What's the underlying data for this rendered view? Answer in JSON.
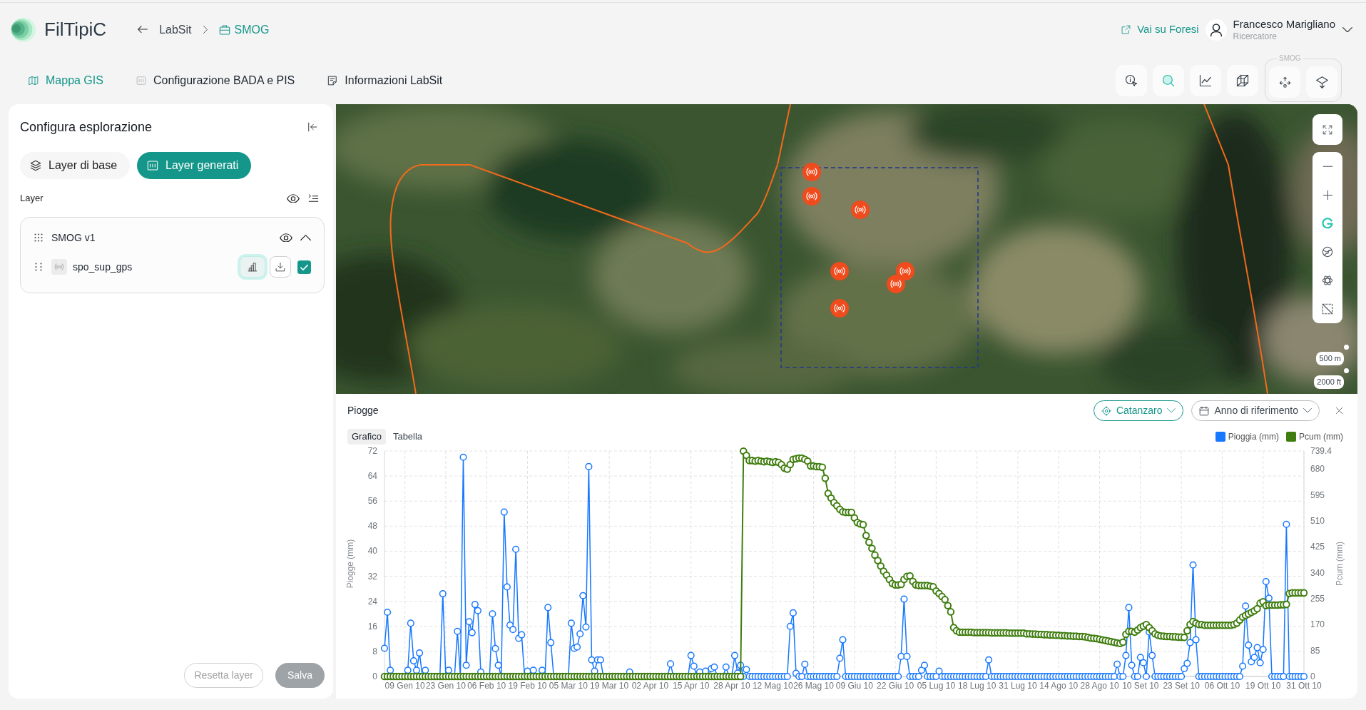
{
  "app": {
    "name": "FilTipiC"
  },
  "breadcrumb": [
    {
      "label": "LabSit",
      "current": false
    },
    {
      "label": "SMOG",
      "current": true
    }
  ],
  "header": {
    "external_link": "Vai su Foresi",
    "user": {
      "name": "Francesco Marigliano",
      "role": "Ricercatore"
    }
  },
  "nav_tabs": [
    {
      "label": "Mappa GIS",
      "selected": true
    },
    {
      "label": "Configurazione BADA e PIS",
      "selected": false
    },
    {
      "label": "Informazioni LabSit",
      "selected": false
    }
  ],
  "toolbar": {
    "tools": [
      {
        "selected": false
      },
      {
        "selected": true
      },
      {
        "selected": false
      },
      {
        "selected": false
      }
    ],
    "group": {
      "label": "SMOG",
      "tools": [
        {
          "selected": false
        },
        {
          "selected": false
        }
      ]
    }
  },
  "sidebar": {
    "title": "Configura esplorazione",
    "segments": [
      {
        "label": "Layer di base",
        "selected": false
      },
      {
        "label": "Layer generati",
        "selected": true
      }
    ],
    "section_label": "Layer",
    "groups": [
      {
        "name": "SMOG v1",
        "expanded": true,
        "layers": [
          {
            "name": "spo_sup_gps",
            "chart_shown": true,
            "checked": true
          }
        ]
      }
    ],
    "buttons": [
      {
        "label": "Resetta layer",
        "kind": "outline",
        "disabled": true
      },
      {
        "label": "Salva",
        "kind": "solid",
        "disabled": true
      }
    ]
  },
  "map": {
    "tools": [
      {
        "selected": true
      },
      {
        "selected": false
      },
      {
        "selected": false
      },
      {
        "selected": false
      }
    ],
    "scale": [
      "500 m",
      "2000 ft"
    ]
  },
  "chart_panel": {
    "title": "Piogge",
    "filters": [
      {
        "label": "Catanzaro",
        "active": true
      },
      {
        "label": "Anno di riferimento",
        "active": false
      }
    ],
    "tabs": [
      {
        "label": "Grafico",
        "selected": true
      },
      {
        "label": "Tabella",
        "selected": false
      }
    ],
    "chart_data": {
      "type": "line",
      "grid": true,
      "legend": "top-right",
      "ylabel": "Piogge (mm)",
      "y2label": "Pcum (mm)",
      "categories": [
        null,
        null,
        null,
        null,
        null,
        null,
        null,
        "09 Gen 10",
        null,
        null,
        null,
        null,
        null,
        null,
        null,
        null,
        null,
        null,
        null,
        null,
        null,
        "23 Gen 10",
        null,
        null,
        null,
        null,
        null,
        null,
        null,
        null,
        null,
        null,
        null,
        null,
        null,
        "06 Feb 10",
        null,
        null,
        null,
        null,
        null,
        null,
        null,
        null,
        null,
        null,
        null,
        null,
        null,
        "19 Feb 10",
        null,
        null,
        null,
        null,
        null,
        null,
        null,
        null,
        null,
        null,
        null,
        null,
        null,
        "05 Mar 10",
        null,
        null,
        null,
        null,
        null,
        null,
        null,
        null,
        null,
        null,
        null,
        null,
        null,
        "19 Mar 10",
        null,
        null,
        null,
        null,
        null,
        null,
        null,
        null,
        null,
        null,
        null,
        null,
        null,
        "02 Apr 10",
        null,
        null,
        null,
        null,
        null,
        null,
        null,
        null,
        null,
        null,
        null,
        null,
        null,
        "15 Apr 10",
        null,
        null,
        null,
        null,
        null,
        null,
        null,
        null,
        null,
        null,
        null,
        null,
        null,
        "28 Apr 10",
        null,
        null,
        null,
        null,
        null,
        null,
        null,
        null,
        null,
        null,
        null,
        null,
        null,
        "12 Mag 10",
        null,
        null,
        null,
        null,
        null,
        null,
        null,
        null,
        null,
        null,
        null,
        null,
        null,
        "26 Mag 10",
        null,
        null,
        null,
        null,
        null,
        null,
        null,
        null,
        null,
        null,
        null,
        null,
        null,
        "09 Giu 10",
        null,
        null,
        null,
        null,
        null,
        null,
        null,
        null,
        null,
        null,
        null,
        null,
        null,
        "22 Giu 10",
        null,
        null,
        null,
        null,
        null,
        null,
        null,
        null,
        null,
        null,
        null,
        null,
        null,
        "05 Lug 10",
        null,
        null,
        null,
        null,
        null,
        null,
        null,
        null,
        null,
        null,
        null,
        null,
        null,
        "18 Lug 10",
        null,
        null,
        null,
        null,
        null,
        null,
        null,
        null,
        null,
        null,
        null,
        null,
        null,
        "31 Lug 10",
        null,
        null,
        null,
        null,
        null,
        null,
        null,
        null,
        null,
        null,
        null,
        null,
        null,
        "14 Ago 10",
        null,
        null,
        null,
        null,
        null,
        null,
        null,
        null,
        null,
        null,
        null,
        null,
        null,
        "28 Ago 10",
        null,
        null,
        null,
        null,
        null,
        null,
        null,
        null,
        null,
        null,
        null,
        null,
        null,
        "10 Set 10",
        null,
        null,
        null,
        null,
        null,
        null,
        null,
        null,
        null,
        null,
        null,
        null,
        null,
        "23 Set 10",
        null,
        null,
        null,
        null,
        null,
        null,
        null,
        null,
        null,
        null,
        null,
        null,
        null,
        "06 Ott 10",
        null,
        null,
        null,
        null,
        null,
        null,
        null,
        null,
        null,
        null,
        null,
        null,
        null,
        "19 Ott 10",
        null,
        null,
        null,
        null,
        null,
        null,
        null,
        null,
        null,
        null,
        null,
        null,
        null,
        "31 Ott 10"
      ],
      "ylim": [
        0,
        72
      ],
      "y2lim": [
        0,
        739.4
      ],
      "yticks": [
        0,
        8,
        16,
        24,
        32,
        40,
        48,
        56,
        64,
        72
      ],
      "y2ticks": [
        0,
        85,
        170,
        255,
        340,
        425,
        510,
        595,
        680,
        739.4
      ],
      "series": [
        {
          "name": "Pioggia (mm)",
          "color": "#1677ff",
          "marker": "circle",
          "values": [
            9,
            20.5,
            2,
            0,
            0,
            0,
            0,
            0,
            2,
            17,
            5,
            2,
            7.5,
            0,
            2,
            0,
            0,
            0,
            0,
            0,
            26.4,
            0,
            2,
            0,
            0,
            14.4,
            0,
            70,
            3.6,
            17.5,
            14,
            23,
            21,
            1.4,
            0,
            0,
            0,
            20,
            8.9,
            3.6,
            0,
            52.5,
            28.6,
            16.4,
            15,
            40.6,
            12.2,
            13.3,
            0,
            1.7,
            0,
            2,
            0,
            0,
            2,
            0,
            22,
            10.8,
            0,
            0,
            0,
            0,
            0,
            0,
            17,
            9,
            9.4,
            13.6,
            25.8,
            15.8,
            67,
            5.3,
            1.7,
            5.3,
            5.3,
            0,
            0,
            0,
            0,
            0,
            0,
            0,
            0,
            0,
            1.4,
            0,
            0,
            0,
            0,
            0,
            0,
            0,
            0,
            0,
            0,
            0,
            0,
            0,
            4,
            0,
            0,
            0,
            0,
            0,
            0,
            6.7,
            3.3,
            0,
            1.4,
            0,
            1.7,
            0,
            2.5,
            3,
            0,
            0,
            0,
            3,
            0,
            0,
            6.7,
            1.1,
            3.6,
            0,
            2.2,
            0,
            0,
            0,
            0,
            0,
            0,
            0,
            0,
            0,
            0,
            0,
            0,
            0,
            0,
            16,
            20.3,
            1,
            0,
            0,
            3.9,
            0,
            0,
            0,
            0,
            0,
            0,
            0,
            0,
            0,
            0,
            0,
            5.8,
            11.7,
            0,
            0,
            0,
            0,
            0,
            0,
            0,
            0,
            0,
            0,
            0,
            0,
            0,
            0,
            0,
            0,
            0,
            0,
            0,
            6.4,
            24.7,
            6.4,
            0,
            0,
            0,
            0,
            2,
            3.6,
            0,
            0,
            0,
            0,
            1.7,
            0,
            0,
            0,
            0,
            0,
            0,
            0,
            0,
            0,
            0,
            0,
            0,
            0,
            0,
            0,
            0,
            5.3,
            0,
            0,
            0,
            0,
            0,
            0,
            0,
            0,
            0,
            0,
            0,
            0,
            0,
            0,
            0,
            0,
            0,
            0,
            0,
            0,
            0,
            0,
            0,
            0,
            0,
            0,
            0,
            0,
            0,
            0,
            0,
            0,
            0,
            0,
            0,
            0,
            0,
            0,
            0,
            0,
            0,
            0,
            0,
            3.9,
            0,
            0,
            6.7,
            22,
            3.6,
            0,
            0,
            6.1,
            4.4,
            0,
            14.2,
            6.7,
            0,
            0,
            0,
            0,
            0,
            0,
            0,
            0,
            0,
            0,
            2.5,
            4.2,
            10.8,
            35.6,
            11.7,
            0,
            0,
            0,
            0,
            0,
            0,
            0,
            0,
            0,
            0,
            0,
            0,
            0,
            0,
            0,
            3.3,
            22.5,
            10,
            4.7,
            6.1,
            9.2,
            4.4,
            8.6,
            30.3,
            25,
            0,
            0,
            0,
            0,
            0,
            48.6,
            0,
            0,
            0,
            0,
            0,
            0
          ]
        },
        {
          "name": "Pcum (mm)",
          "color": "#3f7d0f",
          "axis": "y2",
          "marker": "circle",
          "values": [
            0,
            0,
            0,
            0,
            0,
            0,
            0,
            0,
            0,
            0,
            0,
            0,
            0,
            0,
            0,
            0,
            0,
            0,
            0,
            0,
            0,
            0,
            0,
            0,
            0,
            0,
            0,
            0,
            0,
            0,
            0,
            0,
            0,
            0,
            0,
            0,
            0,
            0,
            0,
            0,
            0,
            0,
            0,
            0,
            0,
            0,
            0,
            0,
            0,
            0,
            0,
            0,
            0,
            0,
            0,
            0,
            0,
            0,
            0,
            0,
            0,
            0,
            0,
            0,
            0,
            0,
            0,
            0,
            0,
            0,
            0,
            0,
            0,
            0,
            0,
            0,
            0,
            0,
            0,
            0,
            0,
            0,
            0,
            0,
            0,
            0,
            0,
            0,
            0,
            0,
            0,
            0,
            0,
            0,
            0,
            0,
            0,
            0,
            0,
            0,
            0,
            0,
            0,
            0,
            0,
            0,
            0,
            0,
            0,
            0,
            0,
            0,
            0,
            0,
            0,
            0,
            0,
            0,
            0,
            0,
            0,
            0,
            0,
            739,
            725,
            708,
            708,
            706,
            708,
            706,
            704,
            706,
            704,
            702,
            704,
            702,
            695,
            683,
            680,
            695,
            712,
            714,
            716,
            716,
            712,
            706,
            690,
            690,
            688,
            688,
            686,
            650,
            600,
            585,
            570,
            560,
            548,
            540,
            538,
            538,
            538,
            520,
            505,
            500,
            498,
            462,
            440,
            420,
            398,
            380,
            362,
            345,
            332,
            318,
            305,
            300,
            300,
            302,
            318,
            328,
            330,
            312,
            300,
            298,
            298,
            298,
            298,
            296,
            294,
            280,
            272,
            262,
            252,
            232,
            212,
            160,
            150,
            145,
            145,
            145,
            145,
            145,
            144,
            144,
            144,
            144,
            144,
            144,
            143,
            143,
            143,
            143,
            143,
            143,
            142,
            142,
            142,
            142,
            142,
            142,
            140,
            140,
            139,
            139,
            138,
            138,
            137,
            137,
            136,
            136,
            135,
            135,
            134,
            134,
            133,
            133,
            132,
            132,
            131,
            131,
            130,
            128,
            126,
            125,
            124,
            122,
            120,
            118,
            116,
            114,
            112,
            110,
            108,
            112,
            138,
            148,
            148,
            145,
            152,
            160,
            165,
            170,
            160,
            150,
            140,
            135,
            133,
            132,
            131,
            131,
            130,
            130,
            129,
            129,
            128,
            150,
            170,
            180,
            175,
            170,
            170,
            168,
            168,
            168,
            168,
            168,
            168,
            168,
            168,
            168,
            168,
            170,
            175,
            185,
            195,
            200,
            205,
            210,
            215,
            222,
            240,
            245,
            232,
            234,
            234,
            234,
            234,
            235,
            235,
            236,
            272,
            274,
            274,
            274,
            274,
            274
          ]
        }
      ]
    }
  }
}
